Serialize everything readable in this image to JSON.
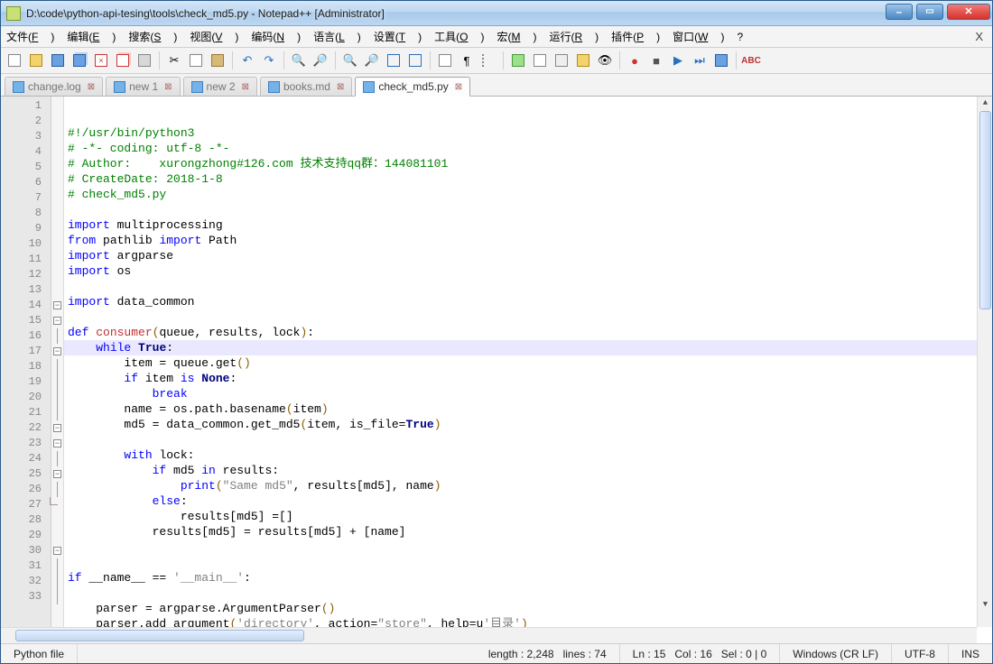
{
  "title": "D:\\code\\python-api-tesing\\tools\\check_md5.py - Notepad++ [Administrator]",
  "menu": {
    "items": [
      "文件(F)",
      "编辑(E)",
      "搜索(S)",
      "视图(V)",
      "编码(N)",
      "语言(L)",
      "设置(T)",
      "工具(O)",
      "宏(M)",
      "运行(R)",
      "插件(P)",
      "窗口(W)",
      "?"
    ]
  },
  "tabs": [
    {
      "label": "change.log",
      "active": false,
      "dirty": true
    },
    {
      "label": "new 1",
      "active": false,
      "dirty": true
    },
    {
      "label": "new 2",
      "active": false,
      "dirty": true
    },
    {
      "label": "books.md",
      "active": false,
      "dirty": true
    },
    {
      "label": "check_md5.py",
      "active": true,
      "dirty": true
    }
  ],
  "status": {
    "lang": "Python file",
    "length_label": "length :",
    "length": "2,248",
    "lines_label": "lines :",
    "lines": "74",
    "ln_label": "Ln :",
    "ln": "15",
    "col_label": "Col :",
    "col": "16",
    "sel_label": "Sel :",
    "sel": "0 | 0",
    "eol": "Windows (CR LF)",
    "enc": "UTF-8",
    "ins": "INS"
  },
  "code": [
    {
      "n": 1,
      "fold": "",
      "spans": [
        [
          "c-comment",
          "#!/usr/bin/python3"
        ]
      ]
    },
    {
      "n": 2,
      "fold": "",
      "spans": [
        [
          "c-comment",
          "# -*- coding: utf-8 -*-"
        ]
      ]
    },
    {
      "n": 3,
      "fold": "",
      "spans": [
        [
          "c-comment",
          "# Author:    xurongzhong#126.com 技术支持qq群：144081101"
        ]
      ]
    },
    {
      "n": 4,
      "fold": "",
      "spans": [
        [
          "c-comment",
          "# CreateDate: 2018-1-8"
        ]
      ]
    },
    {
      "n": 5,
      "fold": "",
      "spans": [
        [
          "c-comment",
          "# check_md5.py"
        ]
      ]
    },
    {
      "n": 6,
      "fold": "",
      "spans": [
        [
          "",
          ""
        ]
      ]
    },
    {
      "n": 7,
      "fold": "",
      "spans": [
        [
          "c-kw",
          "import"
        ],
        [
          "",
          " multiprocessing"
        ]
      ]
    },
    {
      "n": 8,
      "fold": "",
      "spans": [
        [
          "c-kw",
          "from"
        ],
        [
          "",
          " pathlib "
        ],
        [
          "c-kw",
          "import"
        ],
        [
          "",
          " Path"
        ]
      ]
    },
    {
      "n": 9,
      "fold": "",
      "spans": [
        [
          "c-kw",
          "import"
        ],
        [
          "",
          " argparse"
        ]
      ]
    },
    {
      "n": 10,
      "fold": "",
      "spans": [
        [
          "c-kw",
          "import"
        ],
        [
          "",
          " os"
        ]
      ]
    },
    {
      "n": 11,
      "fold": "",
      "spans": [
        [
          "",
          ""
        ]
      ]
    },
    {
      "n": 12,
      "fold": "",
      "spans": [
        [
          "c-kw",
          "import"
        ],
        [
          "",
          " data_common"
        ]
      ]
    },
    {
      "n": 13,
      "fold": "",
      "spans": [
        [
          "",
          ""
        ]
      ]
    },
    {
      "n": 14,
      "fold": "box",
      "spans": [
        [
          "c-kw",
          "def "
        ],
        [
          "c-def",
          "consumer"
        ],
        [
          "c-paren",
          "("
        ],
        [
          "",
          "queue, results, lock"
        ],
        [
          "c-paren",
          ")"
        ],
        [
          "",
          ":"
        ]
      ]
    },
    {
      "n": 15,
      "fold": "box",
      "hl": true,
      "spans": [
        [
          "",
          "    "
        ],
        [
          "c-kw",
          "while"
        ],
        [
          "",
          " "
        ],
        [
          "c-const",
          "True"
        ],
        [
          "",
          ":"
        ]
      ]
    },
    {
      "n": 16,
      "fold": "bar",
      "spans": [
        [
          "",
          "        item = queue.get"
        ],
        [
          "c-paren",
          "()"
        ]
      ]
    },
    {
      "n": 17,
      "fold": "box",
      "spans": [
        [
          "",
          "        "
        ],
        [
          "c-kw",
          "if"
        ],
        [
          "",
          " item "
        ],
        [
          "c-kw",
          "is"
        ],
        [
          "",
          " "
        ],
        [
          "c-const",
          "None"
        ],
        [
          "",
          ":"
        ]
      ]
    },
    {
      "n": 18,
      "fold": "bar",
      "spans": [
        [
          "",
          "            "
        ],
        [
          "c-kw",
          "break"
        ]
      ]
    },
    {
      "n": 19,
      "fold": "bar",
      "spans": [
        [
          "",
          "        name = os.path.basename"
        ],
        [
          "c-paren",
          "("
        ],
        [
          "",
          "item"
        ],
        [
          "c-paren",
          ")"
        ]
      ]
    },
    {
      "n": 20,
      "fold": "bar",
      "spans": [
        [
          "",
          "        md5 = data_common.get_md5"
        ],
        [
          "c-paren",
          "("
        ],
        [
          "",
          "item, is_file="
        ],
        [
          "c-const",
          "True"
        ],
        [
          "c-paren",
          ")"
        ]
      ]
    },
    {
      "n": 21,
      "fold": "bar",
      "spans": [
        [
          "",
          ""
        ]
      ]
    },
    {
      "n": 22,
      "fold": "box",
      "spans": [
        [
          "",
          "        "
        ],
        [
          "c-kw",
          "with"
        ],
        [
          "",
          " lock:"
        ]
      ]
    },
    {
      "n": 23,
      "fold": "box",
      "spans": [
        [
          "",
          "            "
        ],
        [
          "c-kw",
          "if"
        ],
        [
          "",
          " md5 "
        ],
        [
          "c-kw",
          "in"
        ],
        [
          "",
          " results:"
        ]
      ]
    },
    {
      "n": 24,
      "fold": "bar",
      "spans": [
        [
          "",
          "                "
        ],
        [
          "c-kw",
          "print"
        ],
        [
          "c-paren",
          "("
        ],
        [
          "c-str",
          "\"Same md5\""
        ],
        [
          "",
          ", results[md5], name"
        ],
        [
          "c-paren",
          ")"
        ]
      ]
    },
    {
      "n": 25,
      "fold": "box",
      "spans": [
        [
          "",
          "            "
        ],
        [
          "c-kw",
          "else"
        ],
        [
          "",
          ":"
        ]
      ]
    },
    {
      "n": 26,
      "fold": "bar",
      "spans": [
        [
          "",
          "                results[md5] =[]"
        ]
      ]
    },
    {
      "n": 27,
      "fold": "corner",
      "spans": [
        [
          "",
          "            results[md5] = results[md5] + [name]"
        ]
      ]
    },
    {
      "n": 28,
      "fold": "",
      "spans": [
        [
          "",
          ""
        ]
      ]
    },
    {
      "n": 29,
      "fold": "",
      "spans": [
        [
          "",
          ""
        ]
      ]
    },
    {
      "n": 30,
      "fold": "box",
      "spans": [
        [
          "c-kw",
          "if"
        ],
        [
          "",
          " __name__ == "
        ],
        [
          "c-str",
          "'__main__'"
        ],
        [
          "",
          ":"
        ]
      ]
    },
    {
      "n": 31,
      "fold": "bar",
      "spans": [
        [
          "",
          ""
        ]
      ]
    },
    {
      "n": 32,
      "fold": "bar",
      "spans": [
        [
          "",
          "    parser = argparse.ArgumentParser"
        ],
        [
          "c-paren",
          "()"
        ]
      ]
    },
    {
      "n": 33,
      "fold": "bar",
      "spans": [
        [
          "",
          "    parser.add_argument"
        ],
        [
          "c-paren",
          "("
        ],
        [
          "c-str",
          "'directory'"
        ],
        [
          "",
          ", action="
        ],
        [
          "c-str",
          "\"store\""
        ],
        [
          "",
          ", help=u"
        ],
        [
          "c-str",
          "'目录'"
        ],
        [
          "c-paren",
          ")"
        ]
      ]
    }
  ]
}
